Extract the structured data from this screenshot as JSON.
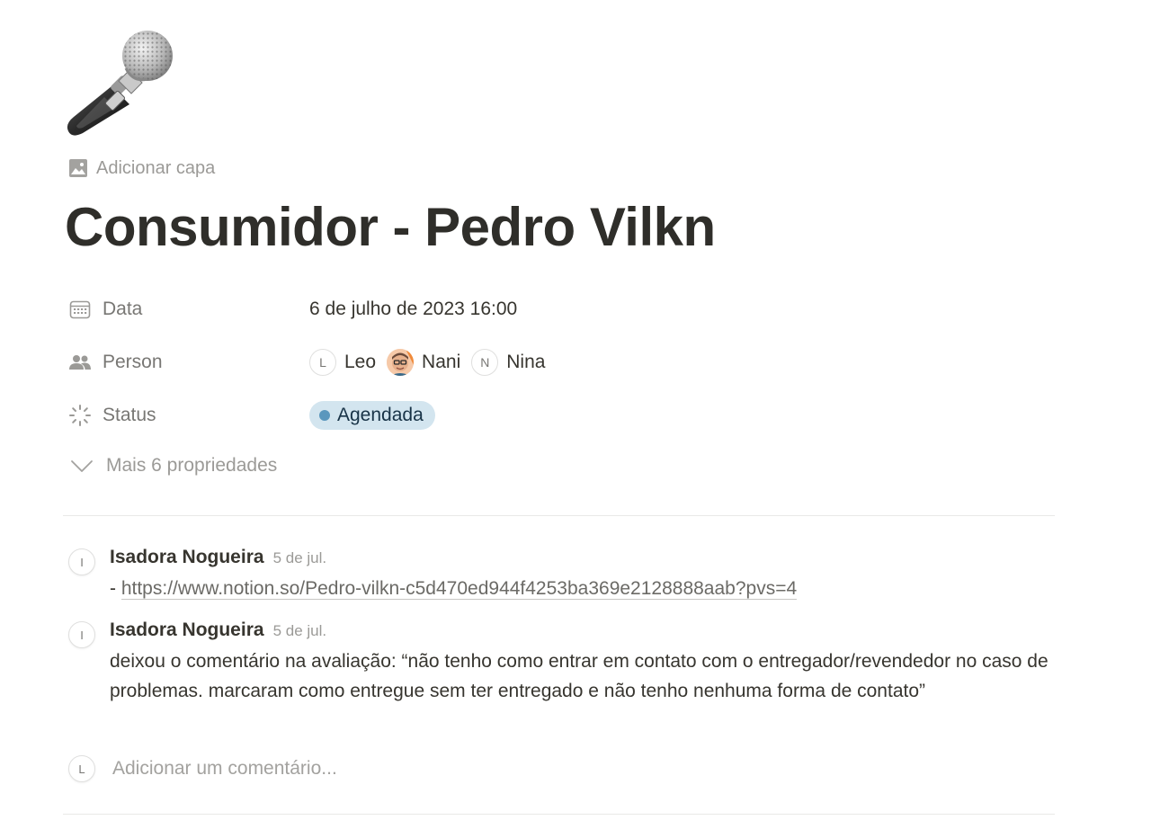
{
  "page": {
    "add_cover_label": "Adicionar capa",
    "title": "Consumidor - Pedro Vilkn"
  },
  "properties": {
    "date": {
      "label": "Data",
      "value": "6 de julho de 2023 16:00"
    },
    "person": {
      "label": "Person",
      "people": [
        {
          "initial": "L",
          "name": "Leo"
        },
        {
          "initial": "",
          "name": "Nani"
        },
        {
          "initial": "N",
          "name": "Nina"
        }
      ]
    },
    "status": {
      "label": "Status",
      "value": "Agendada",
      "color": "#d3e5ef",
      "dot_color": "#5b97bd"
    },
    "more_label": "Mais 6 propriedades"
  },
  "comments": [
    {
      "avatar": "I",
      "author": "Isadora Nogueira",
      "date": "5 de jul.",
      "prefix": "- ",
      "link": "https://www.notion.so/Pedro-vilkn-c5d470ed944f4253ba369e2128888aab?pvs=4"
    },
    {
      "avatar": "I",
      "author": "Isadora Nogueira",
      "date": "5 de jul.",
      "text": "deixou o comentário na avaliação: “não tenho como entrar em contato com o entregador/revendedor no caso de problemas. marcaram como entregue sem ter entregado e não tenho nenhuma forma de contato”"
    }
  ],
  "add_comment": {
    "avatar": "L",
    "placeholder": "Adicionar um comentário..."
  }
}
